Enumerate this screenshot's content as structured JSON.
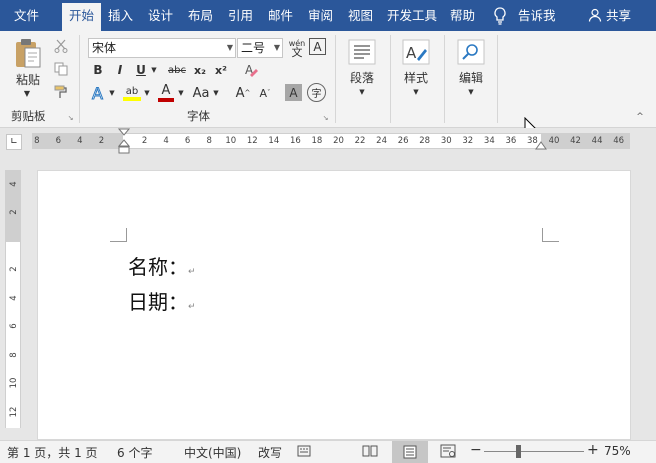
{
  "menu": {
    "file": "文件",
    "tabs": [
      "开始",
      "插入",
      "设计",
      "布局",
      "引用",
      "邮件",
      "审阅",
      "视图",
      "开发工具",
      "帮助"
    ],
    "tell_me": "告诉我",
    "share": "共享"
  },
  "ribbon": {
    "clipboard": {
      "paste": "粘贴",
      "group": "剪贴板"
    },
    "font": {
      "name": "宋体",
      "size": "二号",
      "phonetic_top": "wén",
      "phonetic_bottom": "文",
      "bold": "B",
      "italic": "I",
      "underline": "U",
      "strike": "abc",
      "subscript": "x₂",
      "superscript": "x²",
      "highlight": "ab",
      "font_color": "A",
      "case": "Aa",
      "grow": "A",
      "shrink": "A",
      "group": "字体"
    },
    "paragraph": "段落",
    "styles": "样式",
    "editing": "编辑"
  },
  "ruler": {
    "h_ticks": [
      "8",
      "6",
      "4",
      "2",
      "2",
      "4",
      "6",
      "8",
      "10",
      "12",
      "14",
      "16",
      "18",
      "20",
      "22",
      "24",
      "26",
      "28",
      "30",
      "32",
      "34",
      "36",
      "38",
      "40",
      "42",
      "44",
      "46"
    ],
    "v_ticks": [
      "4",
      "2",
      "2",
      "4",
      "6",
      "8",
      "10",
      "12"
    ]
  },
  "document": {
    "lines": [
      "名称：",
      "日期："
    ]
  },
  "status": {
    "page": "第 1 页，共 1 页",
    "words": "6 个字",
    "language": "中文(中国)",
    "mode": "改写",
    "zoom": "75%",
    "zoom_minus": "−",
    "zoom_plus": "+"
  },
  "colors": {
    "brand": "#2b579a",
    "highlight": "#ffff00",
    "font_color": "#c00000"
  }
}
